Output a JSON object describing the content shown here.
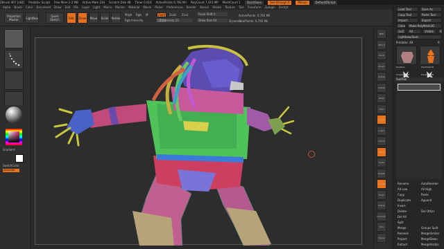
{
  "titlebar": {
    "items": [
      "ZBrush 4R7 [x64]",
      "Predator Sculpt",
      "Free Mem 2.2 MB",
      "Active Mem 234",
      "Scratch Disk 48",
      "Timer 0.016",
      "ActivePoints 6,792 Mil",
      "PolyCount 7,415 MP",
      "MeshCount 1"
    ],
    "quicksave": "QuickSave",
    "see_through": "See-through 0",
    "menus": "Menus",
    "script": "DefaultZScript"
  },
  "menu": [
    "Alpha",
    "Brush",
    "Color",
    "Document",
    "Draw",
    "Edit",
    "File",
    "Layer",
    "Light",
    "Macro",
    "Marker",
    "Material",
    "Movie",
    "Picker",
    "Preferences",
    "Render",
    "Stencil",
    "Stroke",
    "Texture",
    "Tool",
    "Transform",
    "Zplugin",
    "Zscript"
  ],
  "toolbar": {
    "projection_master": "Projection Master",
    "lightbox": "LightBox",
    "quick_sketch": "Quick Sketch",
    "edit": "Edit",
    "draw": "Draw",
    "move": "Move",
    "scale": "Scale",
    "rotate": "Rotate",
    "mrgb": "Mrgb",
    "rgb": "Rgb",
    "m": "M",
    "zadd": "Zadd",
    "zsub": "Zsub",
    "zcut": "Zcut",
    "rgb_intensity": "Rgb Intensity",
    "z_intensity": "Z Intensity 25",
    "focal_shift": "Focal Shift 0",
    "draw_size": "Draw Size 64",
    "dynamic": "Dynamic",
    "active_points": "ActivePoints: 6,792 Mil",
    "total_points": "TotalPoints: 6,792 Mil"
  },
  "left_shelf": {
    "gradient": "Gradient",
    "switch_color": "SwitchColor",
    "alternate": "Alternate"
  },
  "right_shelf": [
    "BPR",
    "SPix 3",
    "Scroll",
    "Zoom",
    "Actual",
    "AAHalf",
    "Persp",
    "Floor",
    "Local",
    "L.Sym",
    "Frame",
    "Move",
    "Scale",
    "Rotate",
    "Line Fill",
    "PolyF",
    "Transp",
    "Dynamic",
    "Solo",
    "Xpose"
  ],
  "tool_panel": {
    "header": [
      "Load Tool",
      "Save As",
      "Copy Tool",
      "Paste Tool",
      "Import",
      "Export",
      "Clone",
      "Make PolyMesh3D",
      "GoZ",
      "All",
      "Visible",
      "R"
    ],
    "lightbox_tools": "Lightbox▸Tools",
    "current_tool": "Predator. 48",
    "r_label": "R",
    "tools": [
      "Predator",
      "PolyMesh3D",
      "SimpleBrush",
      "Predator_48"
    ],
    "subtool": "SubTool",
    "buttons": [
      "Rename",
      "AutoReorder",
      "All Low",
      "All High",
      "Copy",
      "Paste",
      "Duplicate",
      "Append",
      "Insert",
      "Delete",
      "Del Other",
      "Del All",
      "Split",
      "Merge",
      "Remesh",
      "Project",
      "Extract"
    ],
    "groups_split": "Groups Split",
    "merge_similar": "MergeSimilar",
    "merge_down": "MergeDown",
    "merge_visible": "MergeVisible"
  },
  "colors": {
    "accent": "#e8731c",
    "background": "#2a2a2a"
  }
}
